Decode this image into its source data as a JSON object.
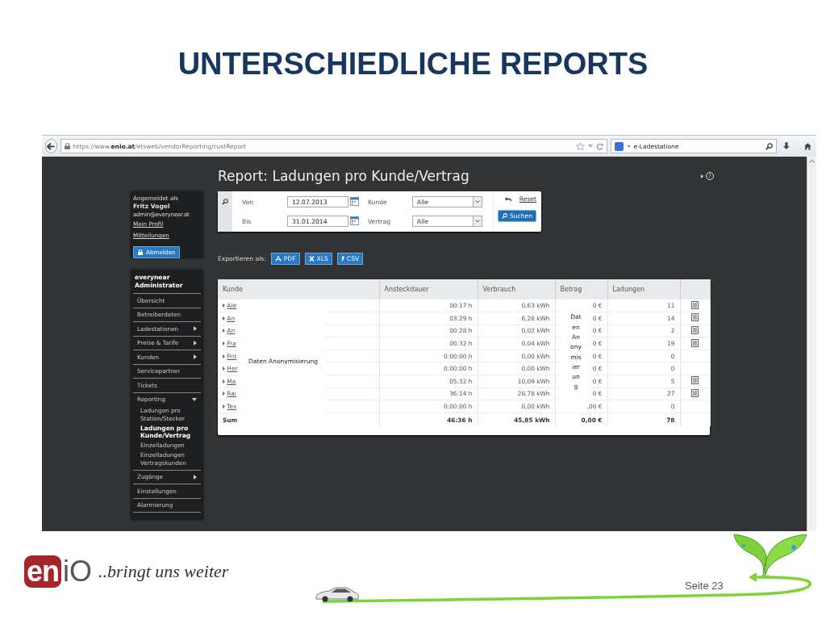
{
  "slide_title": "UNTERSCHIEDLICHE REPORTS",
  "browser": {
    "url": "https://www.**enio.at**/etsweb/vendorReporting/custReport",
    "search_value": "e-Ladestatione"
  },
  "sidebar": {
    "user": {
      "label": "Angemeldet als",
      "name": "Fritz Vogel",
      "email": "admin@everynear.at",
      "links": [
        "Mein Profil",
        "Mitteilungen"
      ],
      "logout": "Abmelden"
    },
    "menu": {
      "title": "everynear Administrator",
      "items": [
        {
          "label": "Übersicht",
          "kind": "plain"
        },
        {
          "label": "Betreiberdaten",
          "kind": "plain"
        },
        {
          "label": "Ladestationen",
          "kind": "submenu"
        },
        {
          "label": "Preise & Tarife",
          "kind": "submenu"
        },
        {
          "label": "Kunden",
          "kind": "submenu"
        },
        {
          "label": "Servicepartner",
          "kind": "plain"
        },
        {
          "label": "Tickets",
          "kind": "plain"
        },
        {
          "label": "Reporting",
          "kind": "open",
          "children": [
            {
              "label": "Ladungen pro Station/Stecker",
              "selected": false
            },
            {
              "label": "Ladungen pro Kunde/Vertrag",
              "selected": true
            },
            {
              "label": "Einzelladungen",
              "selected": false
            },
            {
              "label": "Einzelladungen Vertragskunden",
              "selected": false
            }
          ]
        },
        {
          "label": "Zugänge",
          "kind": "submenu"
        },
        {
          "label": "Einstellungen",
          "kind": "plain"
        },
        {
          "label": "Alarmierung",
          "kind": "plain"
        }
      ]
    }
  },
  "report": {
    "title": "Report: Ladungen pro Kunde/Vertrag",
    "help": "?",
    "filter": {
      "rows": [
        [
          {
            "label": "Von",
            "value": "12.07.2013",
            "kind": "date"
          },
          {
            "label": "Kunde",
            "value": "Alle",
            "kind": "select"
          }
        ],
        [
          {
            "label": "Bis",
            "value": "31.01.2014",
            "kind": "date"
          },
          {
            "label": "Vertrag",
            "value": "Alle",
            "kind": "select"
          }
        ]
      ],
      "reset": "Reset",
      "search": "Suchen"
    },
    "export": {
      "label": "Exportieren als:",
      "buttons": [
        {
          "label": "PDF",
          "kind": "pdf"
        },
        {
          "label": "XLS",
          "kind": "xls"
        },
        {
          "label": "CSV",
          "kind": "csv"
        }
      ]
    },
    "table": {
      "columns": [
        "Kunde",
        "Ansteckdauer",
        "Verbrauch",
        "Betrag",
        "Ladungen"
      ],
      "rows": [
        {
          "kunde": "Ale",
          "dauer": "00:17 h",
          "verbrauch": "0,63 kWh",
          "betrag": "0 €",
          "ladungen": "11",
          "details": true
        },
        {
          "kunde": "An",
          "dauer": "03:29 h",
          "verbrauch": "6,28 kWh",
          "betrag": "0 €",
          "ladungen": "14",
          "details": true
        },
        {
          "kunde": "An",
          "dauer": "00:28 h",
          "verbrauch": "0,02 kWh",
          "betrag": "0 €",
          "ladungen": "2",
          "details": true
        },
        {
          "kunde": "Fra",
          "dauer": "00:32 h",
          "verbrauch": "0,04 kWh",
          "betrag": "0 €",
          "ladungen": "19",
          "details": true
        },
        {
          "kunde": "Frit",
          "dauer": "0:00:00 h",
          "verbrauch": "0,00 kWh",
          "betrag": "0 €",
          "ladungen": "0",
          "details": false
        },
        {
          "kunde": "Her",
          "dauer": "0:00:00 h",
          "verbrauch": "0,00 kWh",
          "betrag": "0 €",
          "ladungen": "0",
          "details": false
        },
        {
          "kunde": "Ma",
          "dauer": "05:32 h",
          "verbrauch": "10,09 kWh",
          "betrag": "0 €",
          "ladungen": "5",
          "details": true
        },
        {
          "kunde": "Rai",
          "dauer": "36:14 h",
          "verbrauch": "28,78 kWh",
          "betrag": "0 €",
          "ladungen": "27",
          "details": true
        },
        {
          "kunde": "Tes",
          "dauer": "0:00:00 h",
          "verbrauch": "0,00 kWh",
          "betrag": ",00 €",
          "ladungen": "0",
          "details": false
        }
      ],
      "sum": {
        "label": "Sum",
        "dauer": "46:36 h",
        "verbrauch": "45,85 kWh",
        "betrag": "0,00 €",
        "ladungen": "78"
      },
      "masks": [
        "Daten Anonymisierung",
        "Daten Anonymisierung"
      ]
    }
  },
  "footer": {
    "logo": {
      "part_1": "en",
      "part_2": "iO"
    },
    "tagline": "..bringt uns  weiter",
    "page": "Seite 23"
  }
}
